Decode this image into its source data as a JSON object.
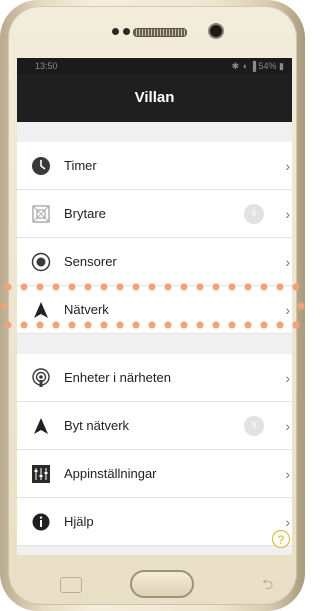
{
  "screen": {
    "title": "Villan",
    "status_time": "13:50",
    "status_icons": "✱ ◖ ▐ 54% ▮"
  },
  "menu": {
    "group1": [
      {
        "label": "Timer",
        "icon": "clock-icon",
        "badge": ""
      },
      {
        "label": "Brytare",
        "icon": "switch-icon",
        "badge": "6"
      },
      {
        "label": "Sensorer",
        "icon": "sensor-icon",
        "badge": ""
      },
      {
        "label": "Nätverk",
        "icon": "network-icon",
        "badge": ""
      }
    ],
    "group2": [
      {
        "label": "Enheter i närheten",
        "icon": "nearby-devices-icon",
        "badge": ""
      },
      {
        "label": "Byt nätverk",
        "icon": "network-icon",
        "badge": "9"
      },
      {
        "label": "Appinställningar",
        "icon": "settings-sliders-icon",
        "badge": ""
      },
      {
        "label": "Hjälp",
        "icon": "info-icon",
        "badge": ""
      }
    ],
    "chevron": "›"
  },
  "help_fab": "?",
  "colors": {
    "highlight": "#f0a47a",
    "titlebar": "#1f1f1f",
    "help_accent": "#e2b030"
  }
}
